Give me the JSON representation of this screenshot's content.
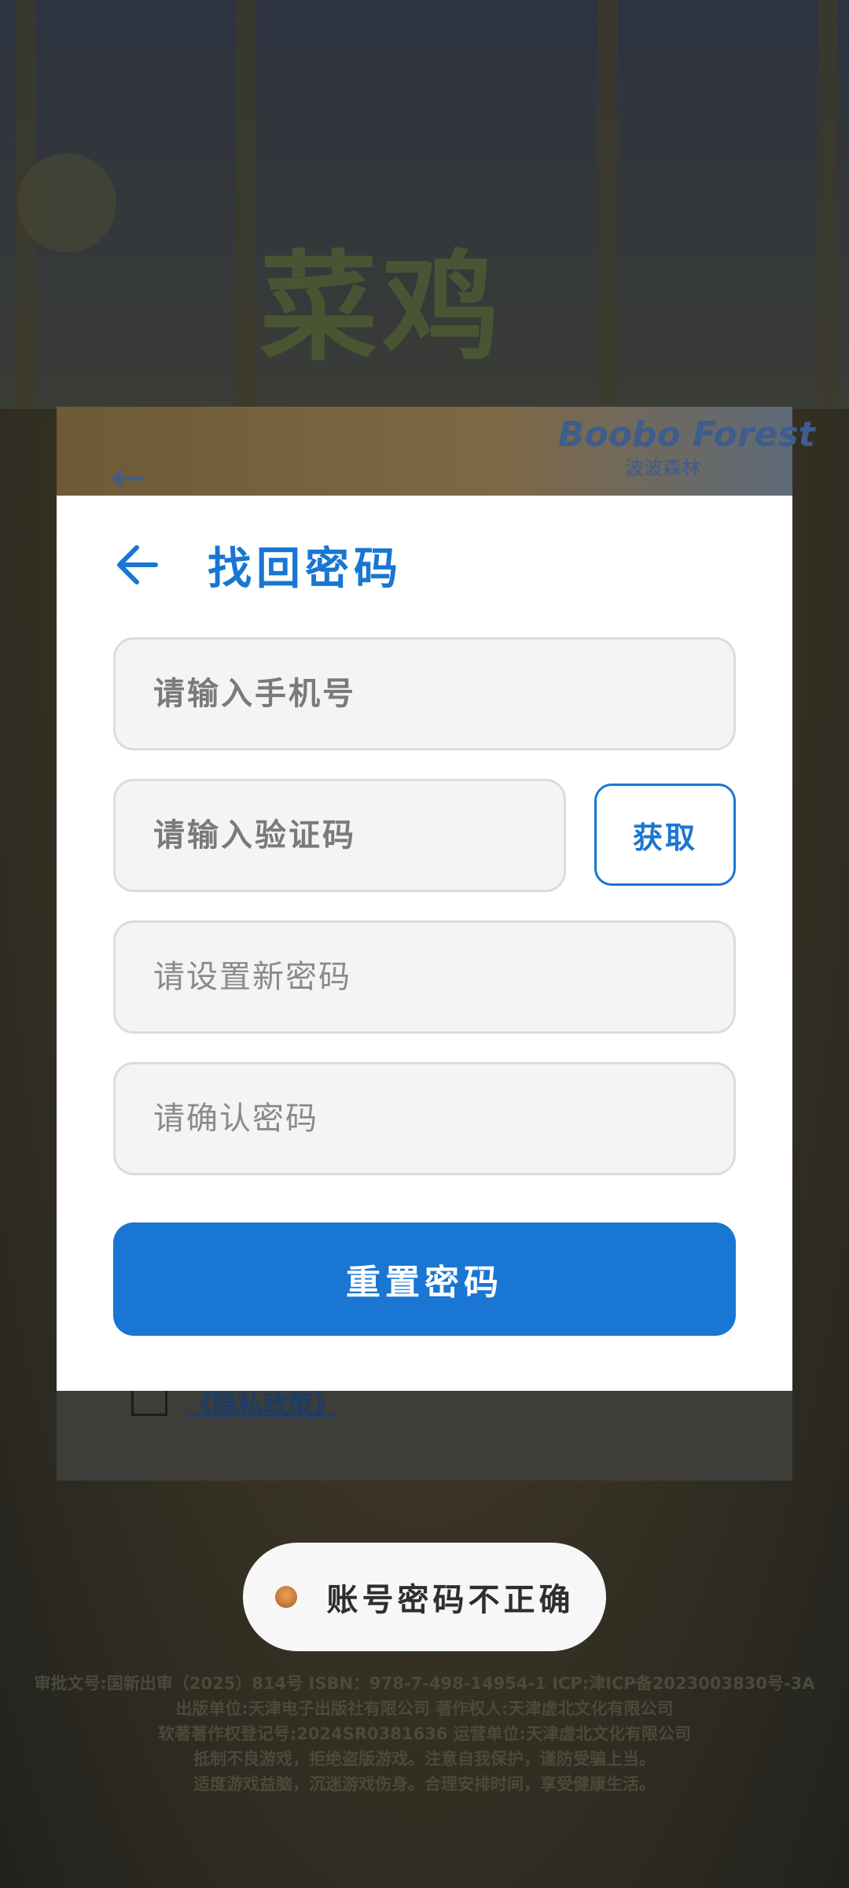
{
  "background": {
    "title": "菜鸡",
    "brand_name": "Boobo Forest",
    "brand_sub": "波波森林",
    "policy_link": "《隐私政策》",
    "legal_lines": [
      "审批文号:国新出审（2025）814号  ISBN：978-7-498-14954-1  ICP:津ICP备2023003830号-3A",
      "出版单位:天津电子出版社有限公司  著作权人:天津虚北文化有限公司",
      "软著著作权登记号:2024SR0381636  运营单位:天津虚北文化有限公司",
      "抵制不良游戏，拒绝盗版游戏。注意自我保护，谨防受骗上当。",
      "适度游戏益脑，沉迷游戏伤身。合理安排时间，享受健康生活。"
    ]
  },
  "modal": {
    "title": "找回密码",
    "back_icon": "arrow-left-icon",
    "accent_color": "#1976d2",
    "phone_placeholder": "请输入手机号",
    "code_placeholder": "请输入验证码",
    "get_code_label": "获取",
    "new_password_placeholder": "请设置新密码",
    "confirm_password_placeholder": "请确认密码",
    "reset_button_label": "重置密码"
  },
  "toast": {
    "icon": "chicken-avatar-icon",
    "message": "账号密码不正确"
  }
}
